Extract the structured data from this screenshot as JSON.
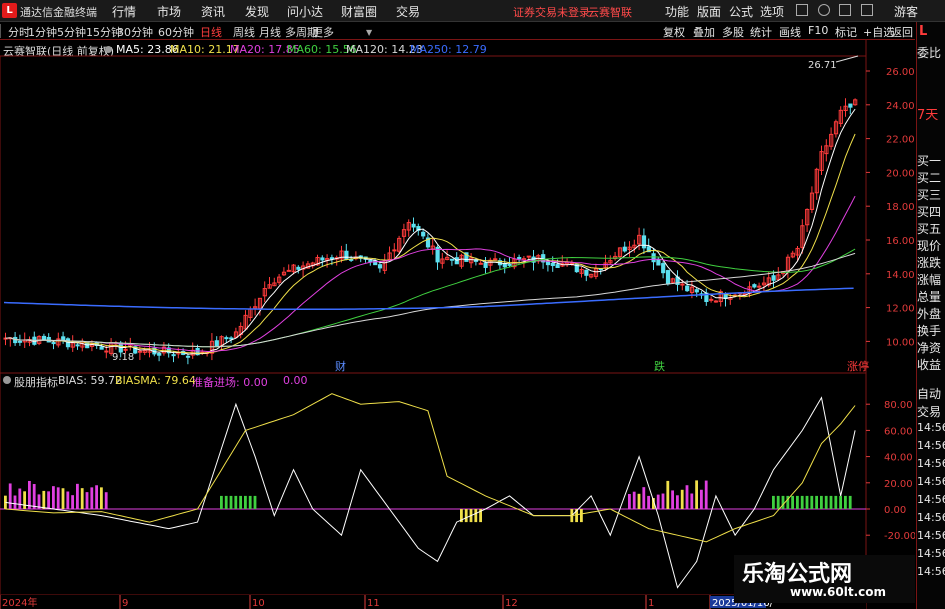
{
  "app": {
    "title": "通达信金融终端",
    "logo": "L"
  },
  "menu": [
    "行情",
    "市场",
    "资讯",
    "发现",
    "问小达",
    "财富圈",
    "交易"
  ],
  "notices": [
    "证券交易未登录",
    "云赛智联"
  ],
  "right_menu": [
    "功能",
    "版面",
    "公式",
    "选项"
  ],
  "user": "游客",
  "periods": [
    "分时",
    "1分钟",
    "5分钟",
    "15分钟",
    "30分钟",
    "60分钟",
    "日线",
    "周线",
    "月线",
    "多周期",
    "更多"
  ],
  "active_period": "日线",
  "tool_buttons": [
    "复权",
    "叠加",
    "多股",
    "统计",
    "画线",
    "F10",
    "标记",
    "+自选",
    "返回"
  ],
  "stock": {
    "name": "云赛智联(日线 前复权)"
  },
  "ma": [
    {
      "label": "MA5: 23.86",
      "color": "#ffffff"
    },
    {
      "label": "MA10: 21.17",
      "color": "#f0e04a"
    },
    {
      "label": "MA20: 17.85",
      "color": "#e040e0"
    },
    {
      "label": "MA60: 15.56",
      "color": "#40d040"
    },
    {
      "label": "MA120: 14.23",
      "color": "#d8d8d8"
    },
    {
      "label": "MA250: 12.79",
      "color": "#3a6cff"
    }
  ],
  "price_axis": [
    "26.00",
    "24.00",
    "22.00",
    "20.00",
    "18.00",
    "16.00",
    "14.00",
    "12.00",
    "10.00"
  ],
  "price_annotations": {
    "high": "26.71",
    "low": "9.18"
  },
  "event_labels": [
    "财",
    "跌",
    "涨停"
  ],
  "indicator": {
    "name": "股朋指标",
    "bias": "BIAS: 59.72",
    "biasma": "BIASMA: 79.64",
    "entry": "准备进场: 0.00",
    "extra": "0.00"
  },
  "ind_axis": [
    "80.00",
    "60.00",
    "40.00",
    "20.00",
    "0.00",
    "-20.00"
  ],
  "date_axis": [
    "2024年",
    "9",
    "10",
    "11",
    "12",
    "1",
    "2025/01/16/"
  ],
  "sidebar": {
    "top": [
      "委比",
      "7天"
    ],
    "quote": [
      "买一",
      "买二",
      "买三",
      "买四",
      "买五",
      "现价",
      "涨跌",
      "涨幅",
      "总量",
      "外盘",
      "换手",
      "净资",
      "收益"
    ],
    "bottom": [
      "自动",
      "交易"
    ],
    "times": [
      "14:56",
      "14:56",
      "14:56",
      "14:56",
      "14:56",
      "14:56",
      "14:56",
      "14:56",
      "14:56"
    ]
  },
  "watermark": {
    "line1": "乐淘公式网",
    "line2": "www.60lt.com"
  }
}
